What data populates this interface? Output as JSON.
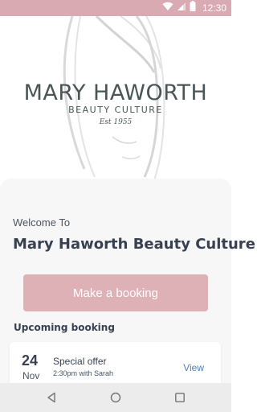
{
  "status_bar": {
    "time": "12:30",
    "bg_color": "#d9aab1",
    "icons": [
      "wifi-icon",
      "signal-icon",
      "battery-icon"
    ]
  },
  "header": {
    "brand_name": "MARY HAWORTH",
    "brand_subtitle": "BEAUTY CULTURE",
    "brand_est": "Est 1955"
  },
  "main": {
    "welcome_text": "Welcome To",
    "app_title": "Mary Haworth Beauty Culture",
    "primary_button": "Make a booking",
    "primary_button_color": "#ddb1b6"
  },
  "upcoming": {
    "section_title": "Upcoming booking",
    "booking": {
      "day": "24",
      "month": "Nov",
      "title": "Special offer",
      "meta": "2:30pm with Sarah",
      "action": "View"
    }
  },
  "nav_bar": {
    "buttons": [
      "back-icon",
      "home-icon",
      "recents-icon"
    ]
  }
}
